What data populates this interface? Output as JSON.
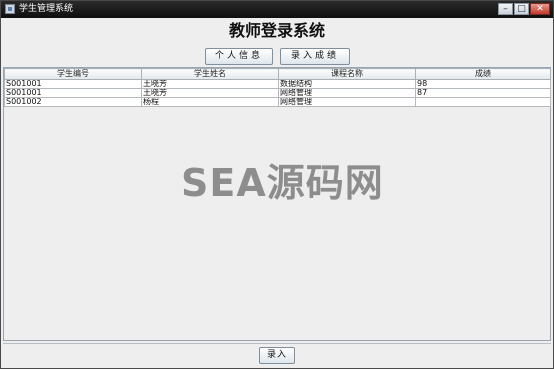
{
  "window": {
    "title": "学生管理系统",
    "buttons": {
      "minimize": "–",
      "maximize": "□",
      "close": "✕"
    }
  },
  "heading": "教师登录系统",
  "toolbar": {
    "personal_info": "个人信息",
    "enter_scores": "录入成绩"
  },
  "table": {
    "columns": [
      "学生编号",
      "学生姓名",
      "课程名称",
      "成绩"
    ],
    "rows": [
      [
        "S001001",
        "王晓芳",
        "数据结构",
        "98"
      ],
      [
        "S001001",
        "王晓芳",
        "网络管理",
        "87"
      ],
      [
        "S001002",
        "杨程",
        "网络管理",
        ""
      ]
    ]
  },
  "watermark": "SEA源码网",
  "footer": {
    "submit": "录入"
  }
}
